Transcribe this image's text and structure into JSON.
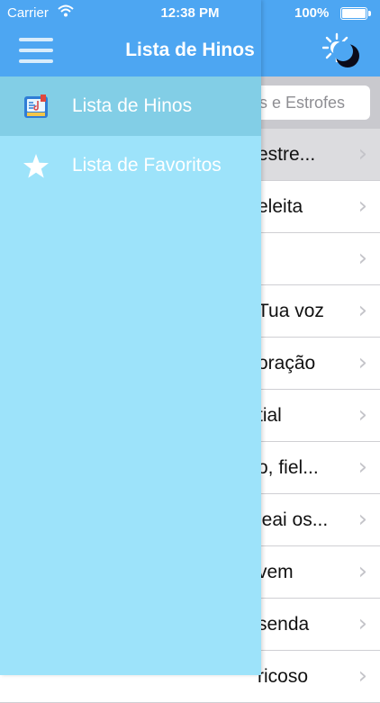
{
  "status_bar": {
    "carrier": "Carrier",
    "time": "12:38 PM",
    "battery": "100%"
  },
  "header": {
    "title": "Lista de Hinos"
  },
  "search": {
    "placeholder": "s e Estrofes"
  },
  "hymns": [
    "estre...",
    "eleita",
    "",
    "Tua voz",
    "oração",
    "tial",
    "o, fiel...",
    "jeai os...",
    "vem",
    "senda",
    "ricoso"
  ],
  "drawer": {
    "items": [
      {
        "label": "Lista de Hinos",
        "icon": "hymn-book-icon"
      },
      {
        "label": "Lista de Favoritos",
        "icon": "star-icon"
      }
    ]
  },
  "colors": {
    "nav": "#4da6f2",
    "drawer": "#9de3fa",
    "drawer_active": "#82cee6"
  }
}
